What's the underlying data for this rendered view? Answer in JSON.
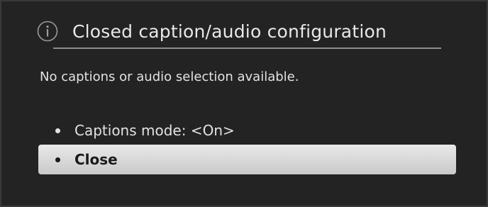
{
  "dialog": {
    "title": "Closed caption/audio configuration",
    "icon": "info-icon",
    "message": "No captions or audio selection available."
  },
  "menu": {
    "items": [
      {
        "label": "Captions mode: <On>",
        "selected": false
      },
      {
        "label": "Close",
        "selected": true
      }
    ]
  },
  "colors": {
    "background": "#232323",
    "text": "#e6e6e6",
    "highlight": "#dcdcdc",
    "highlight_text": "#1a1a1a"
  }
}
